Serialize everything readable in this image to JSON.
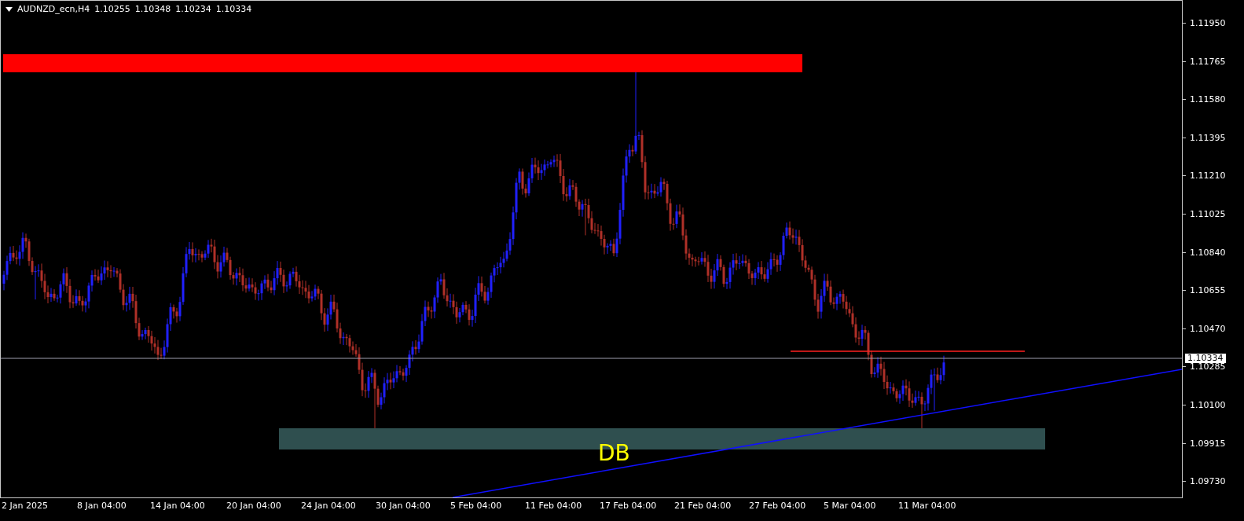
{
  "header": {
    "symbol": "AUDNZD_ecn,H4",
    "open": "1.10255",
    "high": "1.10348",
    "low": "1.10234",
    "close": "1.10334"
  },
  "price_axis": [
    "1.11950",
    "1.11765",
    "1.11580",
    "1.11395",
    "1.11210",
    "1.11025",
    "1.10840",
    "1.10655",
    "1.10470",
    "1.10285",
    "1.10100",
    "1.09915",
    "1.09730"
  ],
  "current_price": "1.10334",
  "time_axis": [
    "2 Jan 2025",
    "8 Jan 04:00",
    "14 Jan 04:00",
    "20 Jan 04:00",
    "24 Jan 04:00",
    "30 Jan 04:00",
    "5 Feb 04:00",
    "11 Feb 04:00",
    "17 Feb 04:00",
    "21 Feb 04:00",
    "27 Feb 04:00",
    "5 Mar 04:00",
    "11 Mar 04:00"
  ],
  "zones": [
    {
      "kind": "resistance",
      "color": "#ff0000"
    },
    {
      "kind": "support",
      "color": "#2f4f4f",
      "label": "DB"
    }
  ]
}
